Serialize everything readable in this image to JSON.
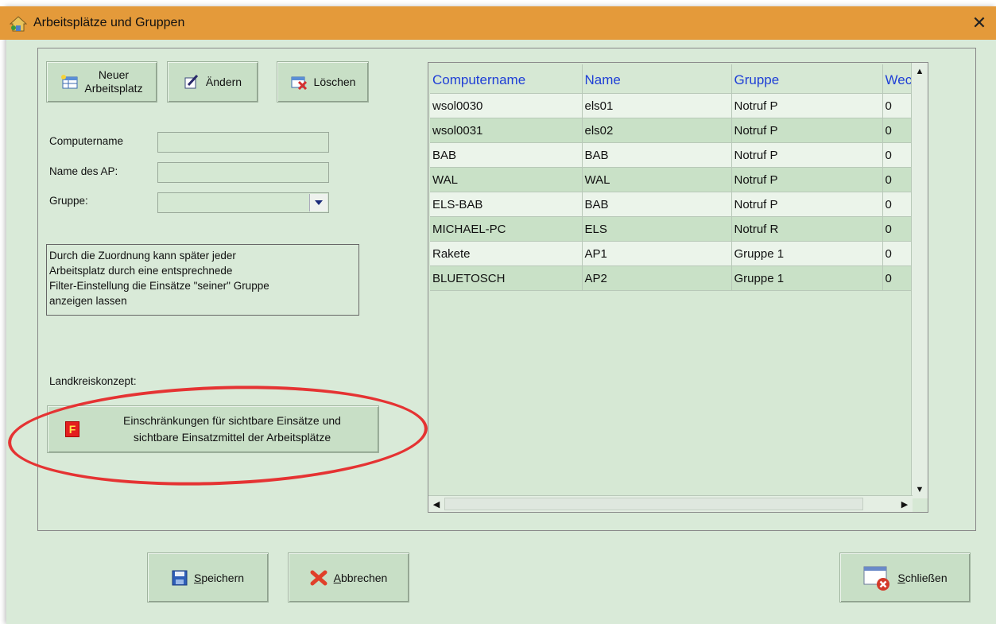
{
  "window": {
    "title": "Arbeitsplätze und Gruppen",
    "close_glyph": "✕"
  },
  "toolbar": {
    "new_line1": "Neuer",
    "new_line2": "Arbeitsplatz",
    "edit": "Ändern",
    "delete": "Löschen"
  },
  "form": {
    "computername_label": "Computername",
    "computername_value": "",
    "ap_name_label": "Name des AP:",
    "ap_name_value": "",
    "group_label": "Gruppe:",
    "group_value": ""
  },
  "info_text": "Durch die Zuordnung kann später jeder\nArbeitsplatz durch eine entsprechnede\nFilter-Einstellung die Einsätze \"seiner\" Gruppe\nanzeigen lassen",
  "landkreis": {
    "label": "Landkreiskonzept:",
    "button_badge": "F",
    "button_line1": "Einschränkungen für sichtbare Einsätze und",
    "button_line2": "sichtbare Einsatzmittel der Arbeitsplätze"
  },
  "table": {
    "columns": [
      "Computername",
      "Name",
      "Gruppe",
      "Wec"
    ],
    "rows": [
      [
        "wsol0030",
        "els01",
        "Notruf P",
        "0"
      ],
      [
        "wsol0031",
        "els02",
        "Notruf P",
        "0"
      ],
      [
        "BAB",
        "BAB",
        "Notruf P",
        "0"
      ],
      [
        "WAL",
        "WAL",
        "Notruf P",
        "0"
      ],
      [
        "ELS-BAB",
        "BAB",
        "Notruf P",
        "0"
      ],
      [
        "MICHAEL-PC",
        "ELS",
        "Notruf R",
        "0"
      ],
      [
        "Rakete",
        "AP1",
        "Gruppe 1",
        "0"
      ],
      [
        "BLUETOSCH",
        "AP2",
        "Gruppe 1",
        "0"
      ]
    ]
  },
  "footer": {
    "save_mnemonic": "S",
    "save_rest": "peichern",
    "cancel_mnemonic": "A",
    "cancel_rest": "bbrechen",
    "close_mnemonic": "S",
    "close_rest": "chließen"
  },
  "colors": {
    "title_bar": "#e49a3a",
    "window_bg": "#d9ead8",
    "highlight": "#e53333",
    "header_text": "#1f3fd6"
  }
}
